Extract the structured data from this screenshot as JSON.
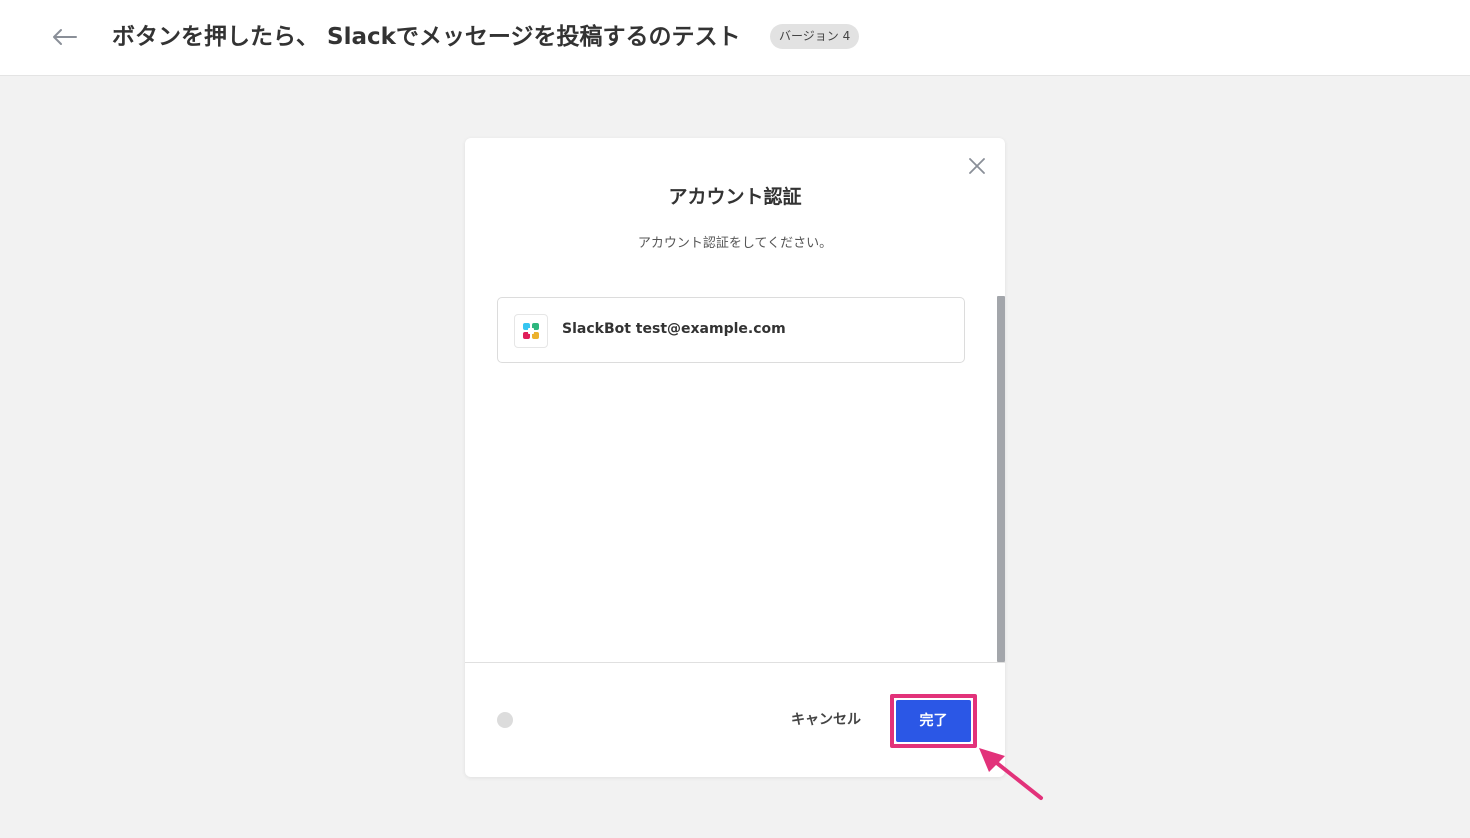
{
  "header": {
    "title": "ボタンを押したら、 Slackでメッセージを投稿するのテスト",
    "version_badge": "バージョン 4"
  },
  "modal": {
    "title": "アカウント認証",
    "subtitle": "アカウント認証をしてください。",
    "account": {
      "label": "SlackBot test@example.com",
      "icon": "slack-logo-icon"
    },
    "footer": {
      "cancel_label": "キャンセル",
      "done_label": "完了"
    }
  },
  "colors": {
    "accent": "#2b57e6",
    "highlight": "#e2327a",
    "background": "#f2f2f2"
  }
}
